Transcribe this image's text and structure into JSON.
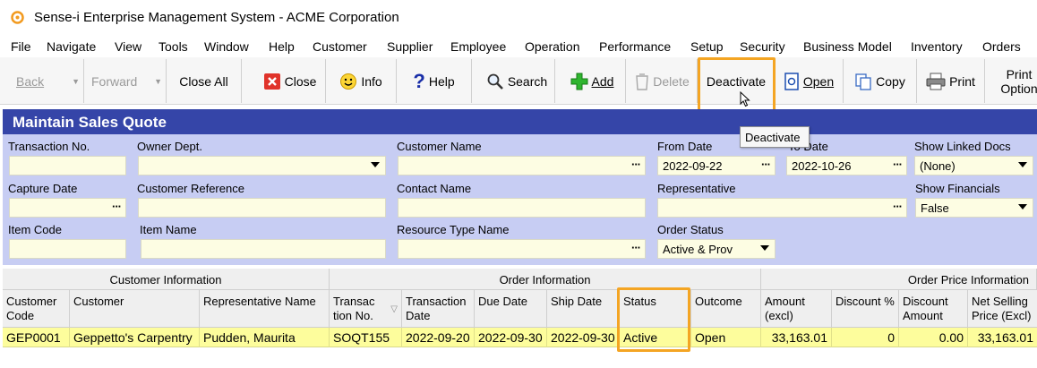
{
  "window": {
    "title": "Sense-i Enterprise Management System - ACME Corporation"
  },
  "menu": [
    "File",
    "Navigate",
    "View",
    "Tools",
    "Window",
    "Help",
    "Customer",
    "Supplier",
    "Employee",
    "Operation",
    "Performance",
    "Setup",
    "Security",
    "Business Model",
    "Inventory",
    "Orders"
  ],
  "toolbar": {
    "back": "Back",
    "forward": "Forward",
    "close_all": "Close All",
    "close": "Close",
    "info": "Info",
    "help": "Help",
    "search": "Search",
    "add": "Add",
    "delete": "Delete",
    "deactivate": "Deactivate",
    "open": "Open",
    "copy": "Copy",
    "print": "Print",
    "print_options_line1": "Print",
    "print_options_line2": "Option"
  },
  "tooltip": "Deactivate",
  "form": {
    "title": "Maintain Sales Quote",
    "labels": {
      "transaction_no": "Transaction No.",
      "owner_dept": "Owner Dept.",
      "customer_name": "Customer Name",
      "from_date": "From Date",
      "to_date": "To Date",
      "show_linked_docs": "Show Linked Docs",
      "capture_date": "Capture Date",
      "customer_reference": "Customer Reference",
      "contact_name": "Contact Name",
      "representative": "Representative",
      "show_financials": "Show Financials",
      "item_code": "Item Code",
      "item_name": "Item Name",
      "resource_type_name": "Resource Type Name",
      "order_status": "Order Status"
    },
    "values": {
      "transaction_no": "",
      "owner_dept": "",
      "customer_name": "",
      "from_date": "2022-09-22",
      "to_date": "2022-10-26",
      "show_linked_docs": "(None)",
      "capture_date": "",
      "customer_reference": "",
      "contact_name": "",
      "representative": "",
      "show_financials": "False",
      "item_code": "",
      "item_name": "",
      "resource_type_name": "",
      "order_status": "Active & Prov"
    },
    "ellipsis": "···"
  },
  "grid": {
    "groups": {
      "customer": "Customer Information",
      "order": "Order Information",
      "price": "Order Price Information"
    },
    "columns": {
      "customer_code": [
        "Customer",
        "Code"
      ],
      "customer": [
        "Customer",
        ""
      ],
      "rep_name": [
        "Representative Name",
        ""
      ],
      "transaction_no": [
        "Transac",
        "tion No."
      ],
      "transaction_date": [
        "Transaction",
        "Date"
      ],
      "due_date": [
        "Due Date",
        ""
      ],
      "ship_date": [
        "Ship Date",
        ""
      ],
      "status": [
        "Status",
        ""
      ],
      "outcome": [
        "Outcome",
        ""
      ],
      "amount": [
        "Amount",
        "(excl)"
      ],
      "discount_pct": [
        "Discount %",
        ""
      ],
      "discount_amount": [
        "Discount",
        "Amount"
      ],
      "net_selling": [
        "Net Selling",
        "Price (Excl)"
      ]
    },
    "rows": [
      {
        "customer_code": "GEP0001",
        "customer": "Geppetto's Carpentry",
        "rep_name": "Pudden, Maurita",
        "transaction_no": "SOQT155",
        "transaction_date": "2022-09-20",
        "due_date": "2022-09-30",
        "ship_date": "2022-09-30",
        "status": "Active",
        "outcome": "Open",
        "amount": "33,163.01",
        "discount_pct": "0",
        "discount_amount": "0.00",
        "net_selling": "33,163.01"
      }
    ]
  },
  "colors": {
    "accent_highlight": "#f4a523",
    "form_header": "#3545a8",
    "form_bg": "#c7cdf3",
    "row_selected": "#fdfd9c"
  }
}
